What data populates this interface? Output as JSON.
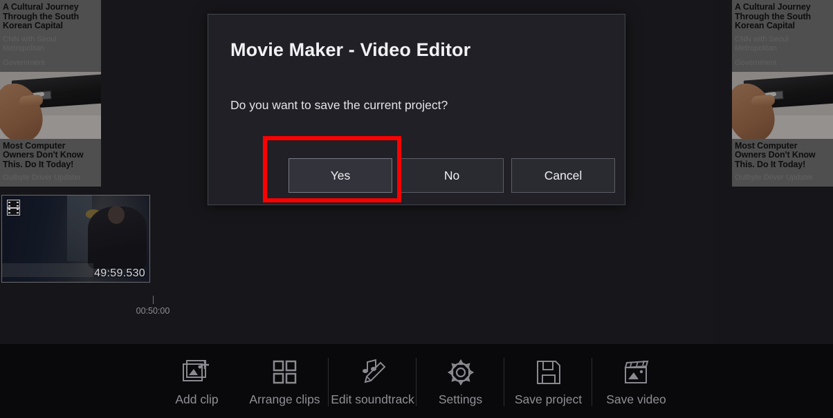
{
  "dialog": {
    "title": "Movie Maker - Video Editor",
    "message": "Do you want to save the current project?",
    "buttons": [
      {
        "label": "Yes",
        "focused": true
      },
      {
        "label": "No",
        "focused": false
      },
      {
        "label": "Cancel",
        "focused": false
      }
    ],
    "highlight_color": "#ff0000"
  },
  "ads": [
    {
      "headline": "A Cultural Journey Through the South Korean Capital",
      "source": "CNN with Seoul Metropolitan",
      "source_line2": "Government"
    },
    {
      "headline": "Most Computer Owners Don't Know This. Do It Today!",
      "source": "Outbyte Driver Updater",
      "source_line2": ""
    }
  ],
  "timeline": {
    "clip": {
      "duration": "49:59.530",
      "icon": "film-strip-icon"
    },
    "marker_label": "00:50:00"
  },
  "toolbar": {
    "items": [
      {
        "label": "Add clip",
        "icon": "add-image-icon",
        "divider": false
      },
      {
        "label": "Arrange clips",
        "icon": "grid-icon",
        "divider": false
      },
      {
        "label": "Edit soundtrack",
        "icon": "music-pencil-icon",
        "divider": true
      },
      {
        "label": "Settings",
        "icon": "gear-icon",
        "divider": true
      },
      {
        "label": "Save project",
        "icon": "floppy-disk-icon",
        "divider": true
      },
      {
        "label": "Save video",
        "icon": "clapperboard-icon",
        "divider": true
      }
    ]
  }
}
